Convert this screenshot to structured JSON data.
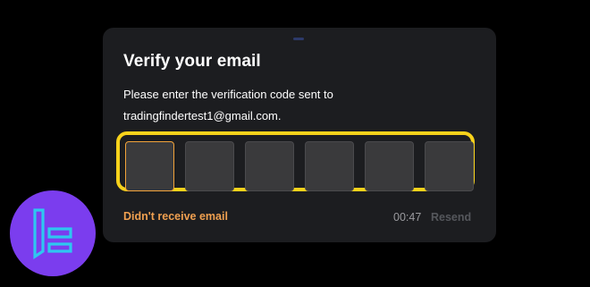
{
  "dialog": {
    "title": "Verify your email",
    "message_line1": "Please enter the verification code sent to",
    "message_line2": "tradingfindertest1@gmail.com.",
    "code_digits": [
      "",
      "",
      "",
      "",
      "",
      ""
    ],
    "resend_prompt": "Didn't receive email",
    "countdown": "00:47",
    "resend_label": "Resend"
  },
  "colors": {
    "modal_bg": "#1c1d20",
    "highlight": "#f7d21b",
    "accent": "#f0a050",
    "logo_bg": "#7b3dee",
    "logo_mark": "#2ec7f0"
  },
  "icons": {
    "brand": "tradingfinder-logo-icon"
  }
}
